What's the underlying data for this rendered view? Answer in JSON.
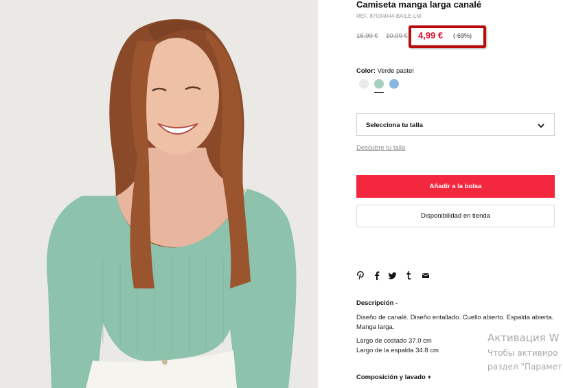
{
  "product": {
    "title": "Camiseta manga larga canalé",
    "ref": "REF. 87034044-BAILE-LM",
    "prices": {
      "original": "15,99 €",
      "previous": "10,99 €",
      "current": "4,99 €",
      "discount": "(-69%)"
    },
    "color": {
      "label": "Color:",
      "value": "Verde pastel",
      "swatches": [
        {
          "name": "blanco",
          "hex": "#e9e9e9"
        },
        {
          "name": "verde pastel",
          "hex": "#a8d0bf",
          "selected": true
        },
        {
          "name": "azul",
          "hex": "#87b6e0"
        }
      ]
    },
    "size": {
      "select_label": "Selecciona tu talla",
      "guide_link": "Descubre tu talla"
    },
    "actions": {
      "add_to_bag": "Añadir a la bolsa",
      "store_availability": "Disponibilidad en tienda"
    },
    "share_icons": [
      "pinterest-icon",
      "facebook-icon",
      "twitter-icon",
      "tumblr-icon",
      "mail-icon"
    ],
    "description": {
      "heading": "Descripción -",
      "text": "Diseño de canalé. Diseño entallado. Cuello abierto. Espalda abierta. Manga larga.",
      "measure_1": "Largo de costado 37.0 cm",
      "measure_2": "Largo de la espalda 34.8 cm"
    },
    "composition": {
      "heading": "Composición y lavado +"
    }
  },
  "watermark": {
    "line1": "Активация W",
    "line2": "Чтобы активиро",
    "line3": "раздел \"Парамет"
  },
  "colors": {
    "accent_red": "#f3283e",
    "price_red": "#e0112b",
    "highlight_border": "#b80b0b"
  }
}
